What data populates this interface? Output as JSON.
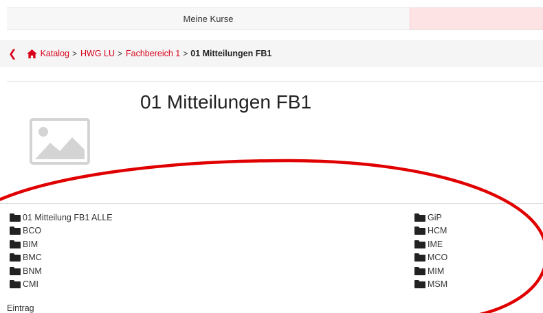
{
  "nav": {
    "tab_courses": "Meine Kurse"
  },
  "breadcrumb": {
    "back_icon": "chevron-left-icon",
    "home_icon": "home-icon",
    "items": [
      "Katalog",
      "HWG LU",
      "Fachbereich 1"
    ],
    "current": "01 Mitteilungen FB1",
    "separator": ">"
  },
  "page": {
    "title": "01 Mitteilungen FB1",
    "image_icon": "image-placeholder-icon"
  },
  "folders": {
    "icon": "folder-icon",
    "left": [
      "01 Mitteilung FB1 ALLE",
      "BCO",
      "BIM",
      "BMC",
      "BNM",
      "CMI"
    ],
    "right": [
      "GiP",
      "HCM",
      "IME",
      "MCO",
      "MIM",
      "MSM"
    ]
  },
  "footer": {
    "entry_label": "Eintrag"
  },
  "colors": {
    "accent": "#d9001b",
    "annotation": "#e00000",
    "tab_highlight": "#fde3e3"
  }
}
